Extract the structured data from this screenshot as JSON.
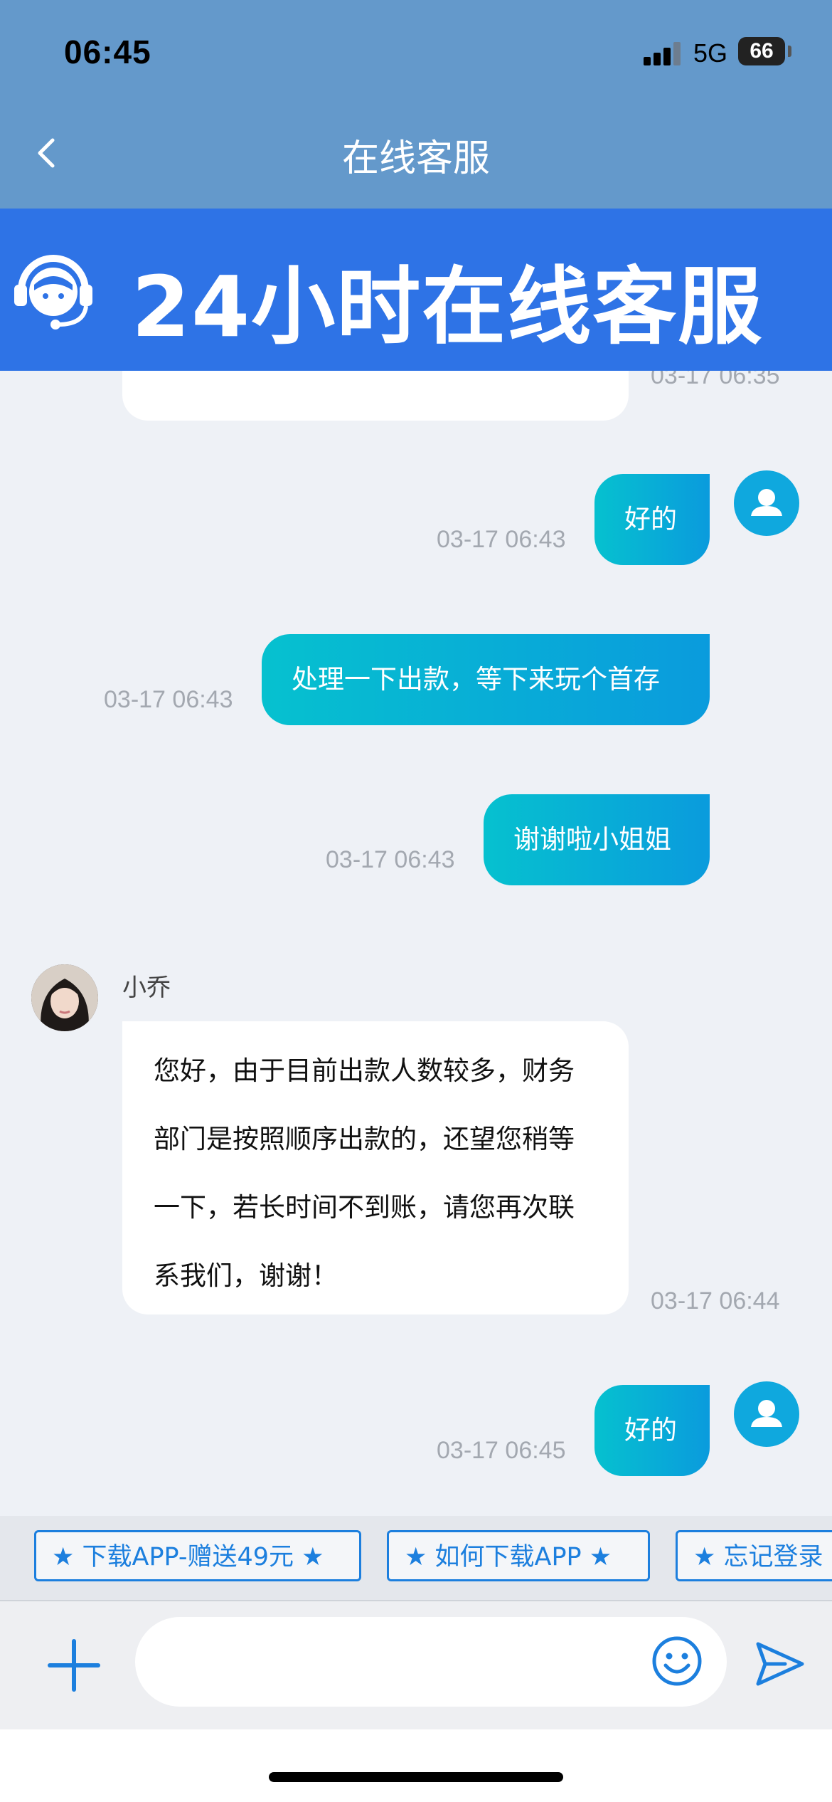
{
  "status_bar": {
    "time": "06:45",
    "network": "5G",
    "battery": "66"
  },
  "nav": {
    "title": "在线客服"
  },
  "banner": {
    "text": "24小时在线客服"
  },
  "messages": [
    {
      "side": "left",
      "text": "",
      "time": "03-17 06:35"
    },
    {
      "side": "right",
      "text": "好的",
      "time": "03-17 06:43"
    },
    {
      "side": "right",
      "text": "处理一下出款，等下来玩个首存",
      "time": "03-17 06:43"
    },
    {
      "side": "right",
      "text": "谢谢啦小姐姐",
      "time": "03-17 06:43"
    },
    {
      "side": "left",
      "sender": "小乔",
      "text": "您好，由于目前出款人数较多，财务部门是按照顺序出款的，还望您稍等一下，若长时间不到账，请您再次联系我们，谢谢！",
      "time": "03-17 06:44"
    },
    {
      "side": "right",
      "text": "好的",
      "time": "03-17 06:45"
    }
  ],
  "quick_replies": [
    "★ 下载APP-赠送49元 ★",
    "★ 如何下载APP ★",
    "★ 忘记登录"
  ],
  "input": {
    "placeholder": ""
  },
  "colors": {
    "header": "#6499cb",
    "banner": "#2e73e6",
    "accent": "#1c7fde",
    "bubble_start": "#06c1cf",
    "bubble_end": "#0a9bdd"
  }
}
